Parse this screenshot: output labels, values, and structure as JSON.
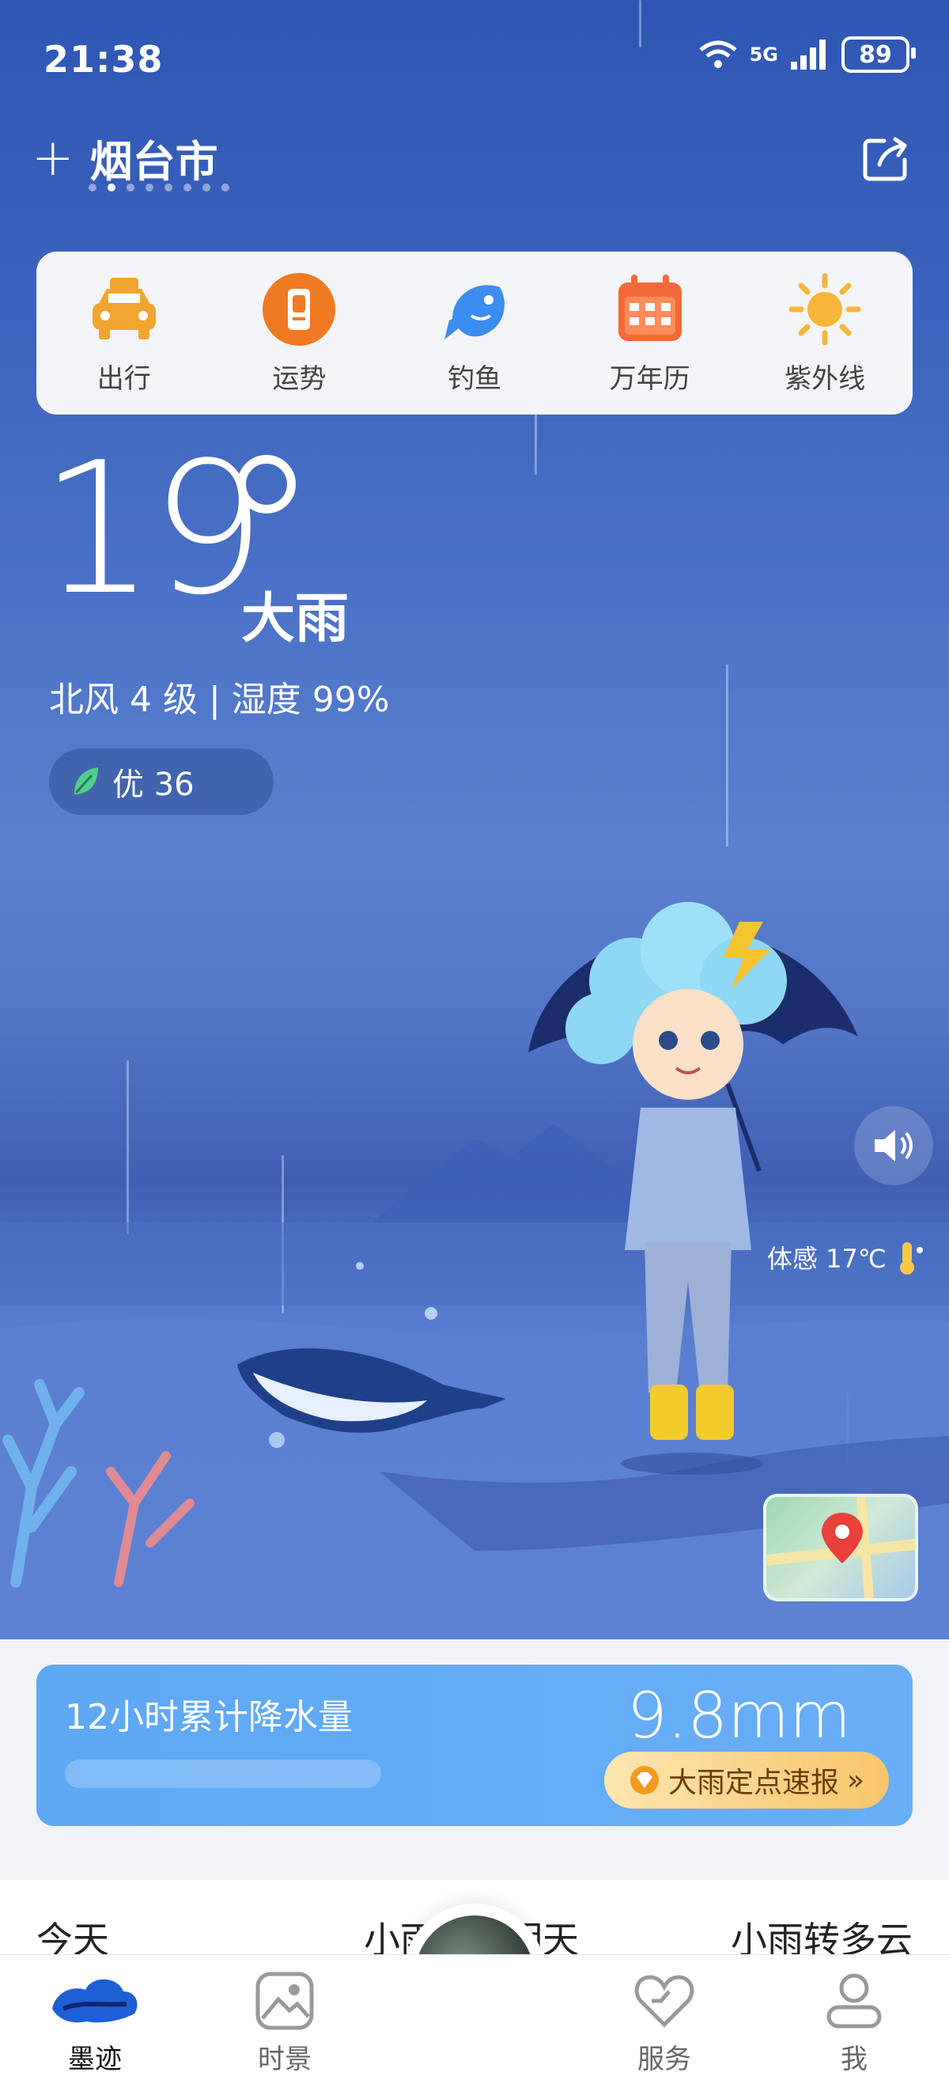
{
  "status_bar": {
    "time": "21:38",
    "network": "5G",
    "battery": "89"
  },
  "header": {
    "city": "烟台市",
    "add_label": "+",
    "page_count": 8,
    "active_page": 2
  },
  "shortcuts": [
    {
      "label": "出行",
      "icon": "taxi-icon"
    },
    {
      "label": "运势",
      "icon": "fortune-icon"
    },
    {
      "label": "钓鱼",
      "icon": "fish-icon"
    },
    {
      "label": "万年历",
      "icon": "calendar-icon"
    },
    {
      "label": "紫外线",
      "icon": "sun-icon"
    }
  ],
  "current": {
    "temperature": "19",
    "condition": "大雨",
    "wind_humidity": "北风 4 级 | 湿度 99%",
    "aqi_label": "优 36",
    "feels_like": "体感 17℃"
  },
  "precip": {
    "title": "12小时累计降水量",
    "value": "9.8mm",
    "report_button": "大雨定点速报"
  },
  "forecast": {
    "today": "今天",
    "today_cond": "小雨",
    "tomorrow": "明天",
    "tomorrow_cond": "小雨转多云"
  },
  "nav": [
    {
      "label": "墨迹",
      "icon": "moji-logo-icon"
    },
    {
      "label": "时景",
      "icon": "photo-icon"
    },
    {
      "label": "服务",
      "icon": "service-heart-icon"
    },
    {
      "label": "我",
      "icon": "profile-icon"
    }
  ],
  "colors": {
    "accent_blue": "#5ea8f4",
    "sky_top": "#2f56b4",
    "taxi": "#f2a531",
    "fortune": "#f07a24",
    "fish": "#3b8df0",
    "calendar": "#f26a3a",
    "sun": "#f7b53b"
  }
}
